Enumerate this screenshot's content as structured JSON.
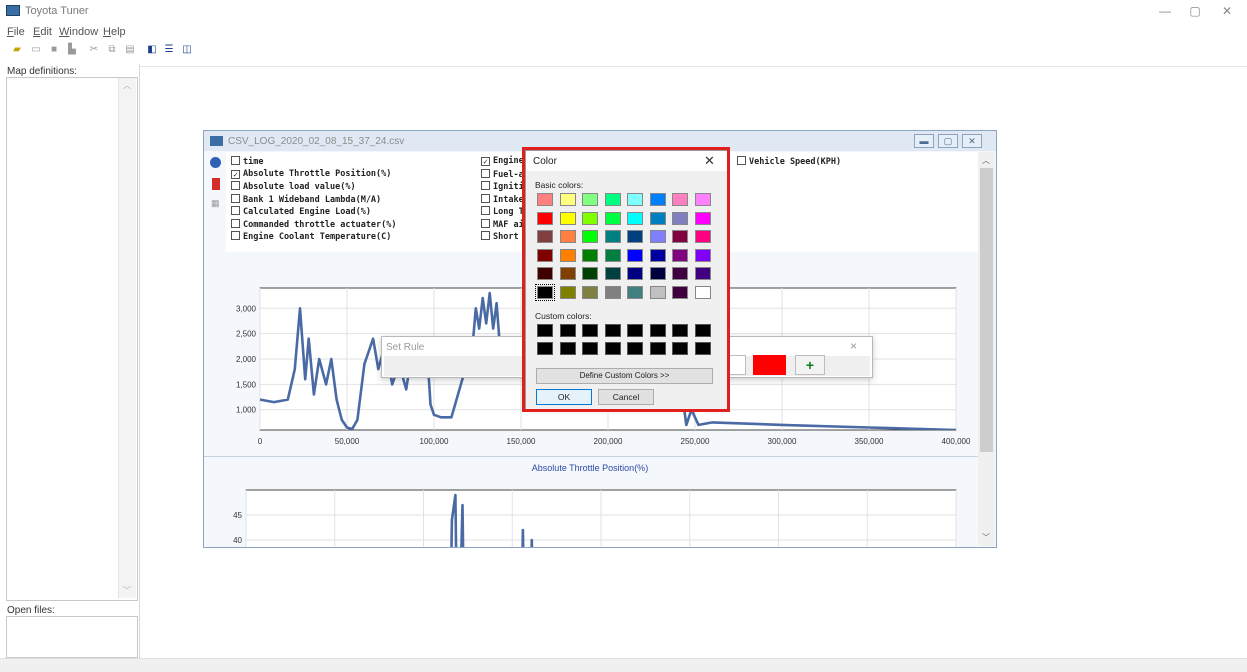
{
  "app": {
    "title": "Toyota Tuner",
    "window_controls": [
      "—",
      "▢",
      "✕"
    ]
  },
  "menu": [
    {
      "label": "File",
      "u": "F",
      "rest": "ile"
    },
    {
      "label": "Edit",
      "u": "E",
      "rest": "dit"
    },
    {
      "label": "Window",
      "u": "W",
      "rest": "indow"
    },
    {
      "label": "Help",
      "u": "H",
      "rest": "elp"
    }
  ],
  "toolbar": {
    "icons": [
      "open-icon",
      "save-icon",
      "print-icon",
      "props-icon",
      "cut-icon",
      "copy-icon",
      "paste-icon",
      "cascade-icon",
      "tile-horizontal-icon",
      "tile-vertical-icon"
    ]
  },
  "sidebar": {
    "map_label": "Map definitions:",
    "open_label": "Open files:"
  },
  "child_window": {
    "title": "CSV_LOG_2020_02_08_15_37_24.csv",
    "checkboxes_col1": [
      {
        "label": "time",
        "checked": false
      },
      {
        "label": "Absolute Throttle Position(%)",
        "checked": true
      },
      {
        "label": "Absolute load value(%)",
        "checked": false
      },
      {
        "label": "Bank 1 Wideband Lambda(M/A)",
        "checked": false
      },
      {
        "label": "Calculated Engine Load(%)",
        "checked": false
      },
      {
        "label": "Commanded throttle actuater(%)",
        "checked": false
      },
      {
        "label": "Engine Coolant Temperature(C)",
        "checked": false
      }
    ],
    "checkboxes_col2": [
      {
        "label": "Engine",
        "checked": true
      },
      {
        "label": "Fuel-a",
        "checked": false
      },
      {
        "label": "Igniti",
        "checked": false
      },
      {
        "label": "Intake",
        "checked": false
      },
      {
        "label": "Long T",
        "checked": false
      },
      {
        "label": "MAF ai",
        "checked": false
      },
      {
        "label": "Short",
        "checked": false
      }
    ],
    "checkboxes_col3": [
      {
        "label": "Vehicle Speed(KPH)",
        "checked": false
      }
    ],
    "chart2_title": "Absolute Throttle Position(%)"
  },
  "chart_data": [
    {
      "type": "line",
      "title": "",
      "xlim": [
        0,
        400000
      ],
      "ylim": [
        600,
        3400
      ],
      "x_ticks": [
        "0",
        "50,000",
        "100,000",
        "150,000",
        "200,000",
        "250,000",
        "300,000",
        "350,000",
        "400,000"
      ],
      "y_ticks": [
        "1,000",
        "1,500",
        "2,000",
        "2,500",
        "3,000"
      ],
      "color": "#4a6aa5",
      "series": [
        {
          "x": [
            0,
            8000,
            16000,
            20000,
            23000,
            26000,
            28000,
            31000,
            34000,
            38000,
            41000,
            44000,
            47000,
            50000,
            53000,
            56000,
            60000,
            65000,
            68000,
            72000,
            76000,
            80000,
            84000,
            88000,
            92000,
            96000,
            98000,
            100000,
            104000,
            110000,
            118000,
            122000,
            124000,
            126000,
            128000,
            130000,
            132000,
            134000,
            136000,
            138000,
            140000,
            145000,
            150000,
            160000,
            170000,
            180000,
            240000,
            245000,
            248000,
            252000,
            260000,
            300000,
            350000,
            400000
          ],
          "y": [
            1200,
            1150,
            1200,
            1800,
            3000,
            1600,
            2400,
            1300,
            2000,
            1500,
            2000,
            1200,
            800,
            650,
            620,
            800,
            1900,
            2400,
            1800,
            2300,
            1500,
            1900,
            1400,
            2300,
            2400,
            2200,
            1100,
            900,
            850,
            850,
            1800,
            2200,
            3000,
            2600,
            3200,
            2700,
            3300,
            2600,
            3100,
            2200,
            2000,
            2000,
            2000,
            2000,
            2000,
            2000,
            2000,
            700,
            1000,
            700,
            750,
            700,
            650,
            600
          ]
        }
      ]
    },
    {
      "type": "line",
      "title": "Absolute Throttle Position(%)",
      "xlim": [
        0,
        400000
      ],
      "ylim": [
        35,
        50
      ],
      "y_ticks": [
        "40",
        "45"
      ],
      "color": "#4a6aa5",
      "series": [
        {
          "x": [
            0,
            115000,
            116000,
            118000,
            119000,
            120000,
            122000,
            123000,
            124000,
            155000,
            156000,
            157000,
            158000,
            160000,
            161000,
            162000,
            163000,
            400000
          ],
          "y": [
            20,
            20,
            44,
            49,
            20,
            20,
            47,
            20,
            20,
            20,
            42,
            20,
            20,
            20,
            40,
            20,
            20,
            20
          ]
        }
      ]
    }
  ],
  "set_rule": {
    "title": "Set Rule",
    "close": "×",
    "add": "+",
    "swatch_color": "#ff0000"
  },
  "color_dialog": {
    "title": "Color",
    "close": "✕",
    "basic_label": "Basic colors:",
    "custom_label": "Custom colors:",
    "define_button": "Define Custom Colors >>",
    "ok_button": "OK",
    "cancel_button": "Cancel",
    "basic_colors": [
      [
        "#ff8080",
        "#ffff80",
        "#80ff80",
        "#00ff80",
        "#80ffff",
        "#0080ff",
        "#ff80c0",
        "#ff80ff"
      ],
      [
        "#ff0000",
        "#ffff00",
        "#80ff00",
        "#00ff40",
        "#00ffff",
        "#0080c0",
        "#8080c0",
        "#ff00ff"
      ],
      [
        "#804040",
        "#ff8040",
        "#00ff00",
        "#008080",
        "#004080",
        "#8080ff",
        "#800040",
        "#ff0080"
      ],
      [
        "#800000",
        "#ff8000",
        "#008000",
        "#008040",
        "#0000ff",
        "#0000a0",
        "#800080",
        "#8000ff"
      ],
      [
        "#400000",
        "#804000",
        "#004000",
        "#004040",
        "#000080",
        "#000040",
        "#400040",
        "#400080"
      ],
      [
        "#000000",
        "#808000",
        "#808040",
        "#808080",
        "#408080",
        "#c0c0c0",
        "#400040",
        "#ffffff"
      ]
    ],
    "custom_colors": [
      [
        "#000000",
        "#000000",
        "#000000",
        "#000000",
        "#000000",
        "#000000",
        "#000000",
        "#000000"
      ],
      [
        "#000000",
        "#000000",
        "#000000",
        "#000000",
        "#000000",
        "#000000",
        "#000000",
        "#000000"
      ]
    ]
  }
}
